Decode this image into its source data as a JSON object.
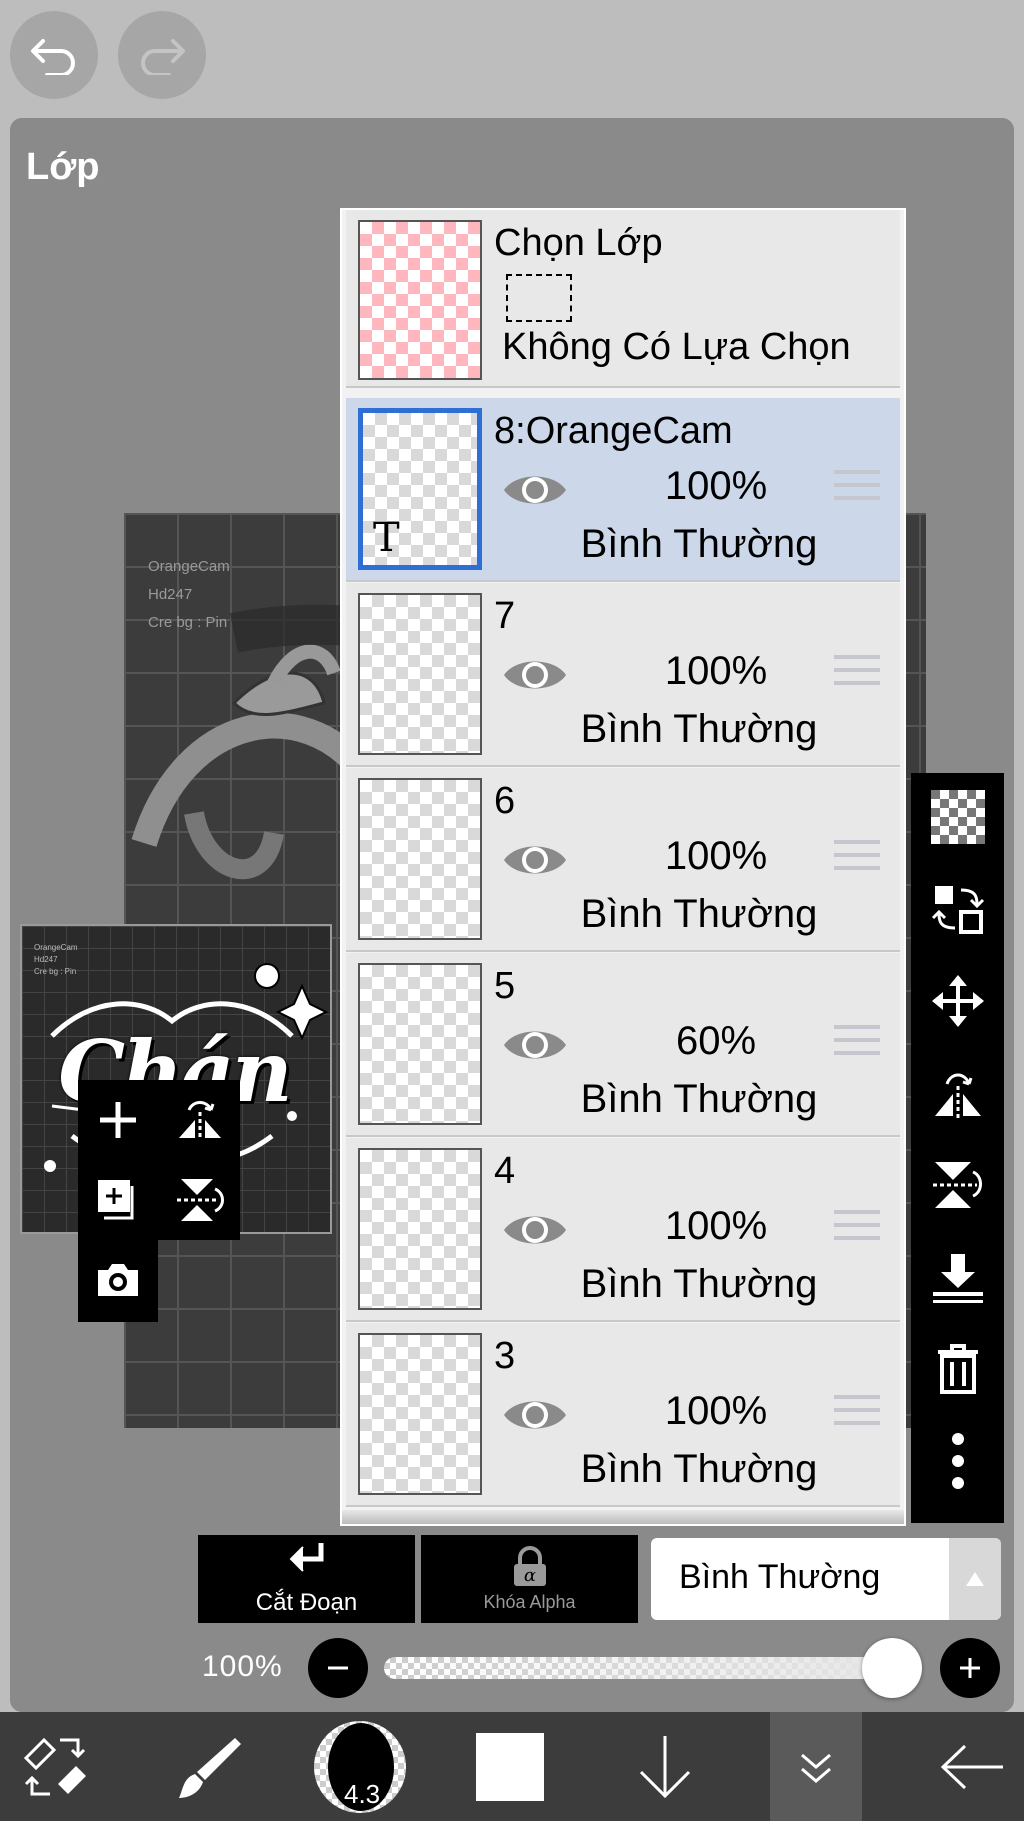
{
  "panel": {
    "title": "Lớp"
  },
  "canvas": {
    "credit_lines": [
      "OrangeCam",
      "Hd247",
      "Cre bg : Pin"
    ]
  },
  "thumbnail": {
    "text": "Chán",
    "credit_lines": [
      "OrangeCam",
      "Hd247",
      "Cre bg : Pin"
    ]
  },
  "selection_layer": {
    "title": "Chọn Lớp",
    "status": "Không Có Lựa Chọn"
  },
  "layers": [
    {
      "name": "8:OrangeCam",
      "opacity": "100%",
      "blend": "Bình Thường",
      "selected": true,
      "text_marker": "T"
    },
    {
      "name": "7",
      "opacity": "100%",
      "blend": "Bình Thường"
    },
    {
      "name": "6",
      "opacity": "100%",
      "blend": "Bình Thường"
    },
    {
      "name": "5",
      "opacity": "60%",
      "blend": "Bình Thường"
    },
    {
      "name": "4",
      "opacity": "100%",
      "blend": "Bình Thường"
    },
    {
      "name": "3",
      "opacity": "100%",
      "blend": "Bình Thường"
    }
  ],
  "controls": {
    "clip_label": "Cắt Đoạn",
    "alpha_lock_label": "Khóa Alpha",
    "blend_mode_value": "Bình Thường",
    "opacity_label": "100%",
    "opacity_value": 1.0
  },
  "footer": {
    "brush_size": "4.3"
  },
  "colors": {
    "selected_row": "#ccd8ea",
    "selected_border": "#2d6fd4",
    "panel": "#8a8a8a"
  }
}
